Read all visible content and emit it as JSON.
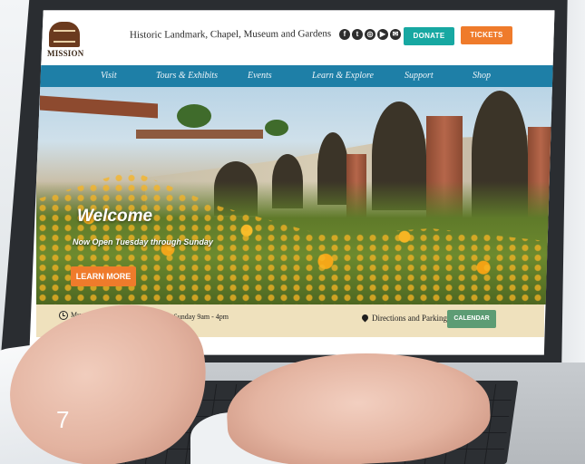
{
  "site": {
    "logo_text": "MISSION",
    "tagline": "Historic Landmark, Chapel, Museum and Gardens",
    "social_icons": [
      "facebook-icon",
      "twitter-icon",
      "instagram-icon",
      "youtube-icon",
      "email-icon"
    ],
    "donate_label": "DONATE",
    "tickets_label": "TICKETS"
  },
  "nav": {
    "items": [
      {
        "label": "Visit"
      },
      {
        "label": "Tours & Exhibits"
      },
      {
        "label": "Events"
      },
      {
        "label": "Learn & Explore"
      },
      {
        "label": "Support"
      },
      {
        "label": "Shop"
      }
    ]
  },
  "hero": {
    "title": "Welcome",
    "subtitle": "Now Open Tuesday through Sunday",
    "cta_label": "LEARN MORE"
  },
  "info_bar": {
    "hours_prefix": "Museum",
    "hours_suffix": "sday - Sunday 9am - 4pm",
    "directions_label": "Directions and Parking",
    "calendar_label": "CALENDAR"
  },
  "page_number": "7",
  "colors": {
    "nav_blue": "#1e7fa7",
    "donate_teal": "#17a8a2",
    "tickets_orange": "#ef7b2b",
    "calendar_green": "#5d9c74",
    "info_bar_tan": "#efe1bd"
  }
}
